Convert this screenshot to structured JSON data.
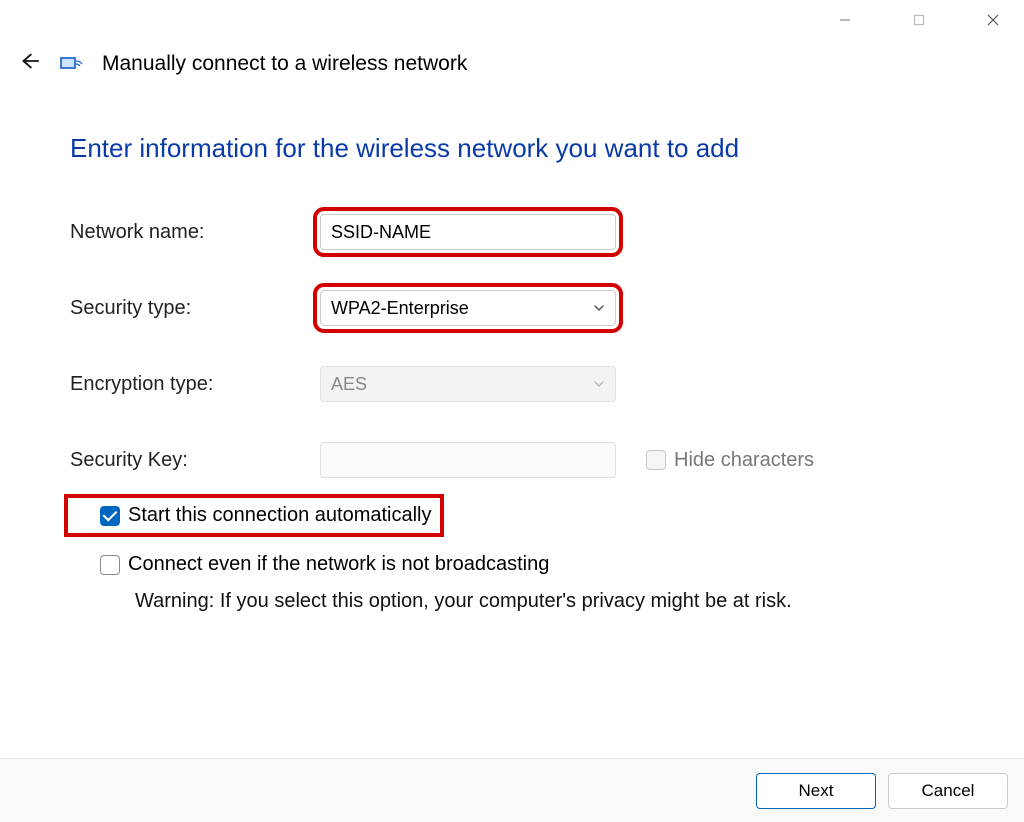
{
  "window": {
    "title": "Manually connect to a wireless network"
  },
  "heading": "Enter information for the wireless network you want to add",
  "form": {
    "network_name_label": "Network name:",
    "network_name_value": "SSID-NAME",
    "security_type_label": "Security type:",
    "security_type_value": "WPA2-Enterprise",
    "encryption_type_label": "Encryption type:",
    "encryption_type_value": "AES",
    "security_key_label": "Security Key:",
    "security_key_value": "",
    "hide_characters_label": "Hide characters",
    "auto_connect_label": "Start this connection automatically",
    "auto_connect_checked": true,
    "connect_hidden_label": "Connect even if the network is not broadcasting",
    "connect_hidden_checked": false,
    "warning_text": "Warning: If you select this option, your computer's privacy might be at risk."
  },
  "buttons": {
    "next": "Next",
    "cancel": "Cancel"
  }
}
